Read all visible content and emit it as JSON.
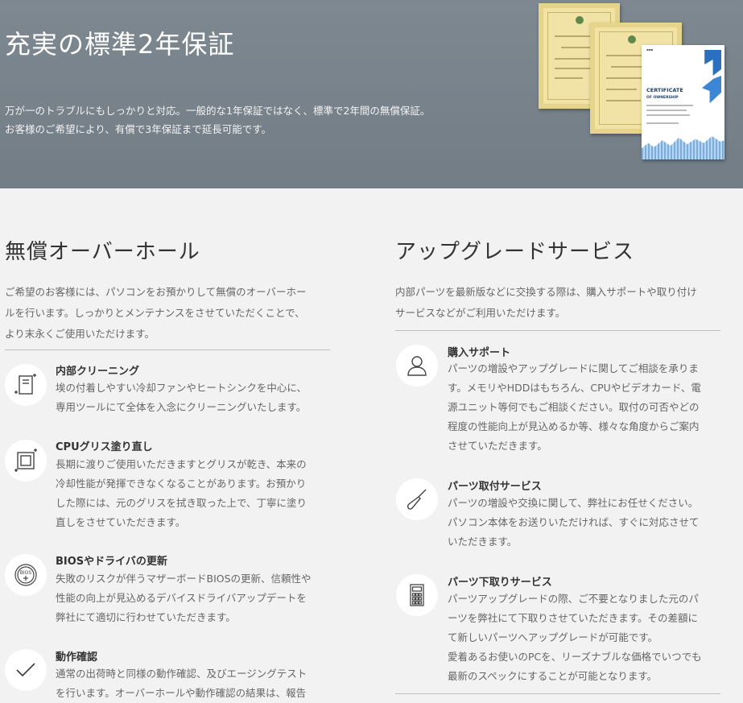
{
  "hero": {
    "title": "充実の標準2年保証",
    "desc": [
      "万が一のトラブルにもしっかりと対応。一般的な1年保証ではなく、標準で2年間の無償保証。",
      "お客様のご希望により、有償で3年保証まで延長可能です。"
    ],
    "certificate_title": "CERTIFICATE",
    "certificate_sub": "OF OWNERSHIP"
  },
  "overhaul": {
    "title": "無償オーバーホール",
    "desc": [
      "ご希望のお客様には、パソコンをお預かりして無償のオーバーホー",
      "ルを行います。しっかりとメンテナンスをさせていただくことで、",
      "より末永くご使用いただけます。"
    ],
    "items": [
      {
        "icon": "pc-case-icon",
        "title": "内部クリーニング",
        "body": [
          "埃の付着しやすい冷却ファンやヒートシンクを中心に、",
          "専用ツールにて全体を入念にクリーニングいたします。"
        ]
      },
      {
        "icon": "cpu-chip-icon",
        "title": "CPUグリス塗り直し",
        "body": [
          "長期に渡りご使用いただきますとグリスが乾き、本来の",
          "冷却性能が発揮できなくなることがあります。お預かり",
          "した際には、元のグリスを拭き取った上で、丁寧に塗り",
          "直しをさせていただきます。"
        ]
      },
      {
        "icon": "bios-update-icon",
        "icon_text": "BIOS",
        "title": "BIOSやドライバの更新",
        "body": [
          "失敗のリスクが伴うマザーボードBIOSの更新、信頼性や",
          "性能の向上が見込めるデバイスドライバアップデートを",
          "弊社にて適切に行わせていただきます。"
        ]
      },
      {
        "icon": "checkmark-icon",
        "title": "動作確認",
        "body": [
          "通常の出荷時と同様の動作確認、及びエージングテスト",
          "を行います。オーバーホールや動作確認の結果は、報告"
        ]
      }
    ]
  },
  "upgrade": {
    "title": "アップグレードサービス",
    "desc": [
      "内部パーツを最新版などに交換する際は、購入サポートや取り付け",
      "サービスなどがご利用いただけます。"
    ],
    "items": [
      {
        "icon": "person-icon",
        "title": "購入サポート",
        "body": [
          "パーツの増設やアップグレードに関してご相談を承りま",
          "す。メモリやHDDはもちろん、CPUやビデオカード、電",
          "源ユニット等何でもご相談ください。取付の可否やどの",
          "程度の性能向上が見込めるか等、様々な角度からご案内",
          "させていただきます。"
        ]
      },
      {
        "icon": "screwdriver-icon",
        "title": "パーツ取付サービス",
        "body": [
          "パーツの増設や交換に関して、弊社にお任せください。",
          "パソコン本体をお送りいただければ、すぐに対応させて",
          "いただきます。"
        ]
      },
      {
        "icon": "calculator-icon",
        "title": "パーツ下取りサービス",
        "body": [
          "パーツアップグレードの際、ご不要となりました元のパ",
          "ーツを弊社にて下取りさせていただきます。その差額に",
          "て新しいパーツへアップグレードが可能です。",
          "愛着あるお使いのPCを、リーズナブルな価格でいつでも",
          "最新のスペックにすることが可能となります。"
        ]
      }
    ]
  }
}
